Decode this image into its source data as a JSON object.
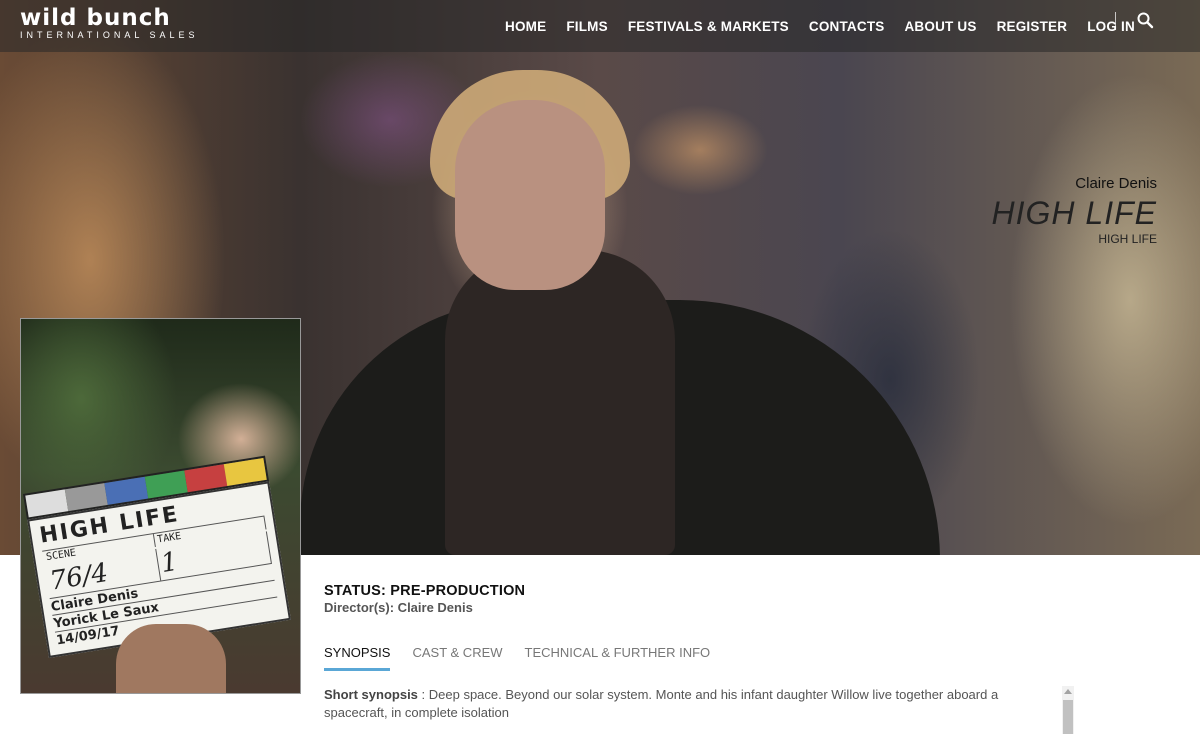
{
  "logo": {
    "main": "wild bunch",
    "sub": "INTERNATIONAL SALES"
  },
  "nav": {
    "items": [
      {
        "label": "HOME"
      },
      {
        "label": "FILMS"
      },
      {
        "label": "FESTIVALS & MARKETS"
      },
      {
        "label": "CONTACTS"
      },
      {
        "label": "ABOUT US"
      },
      {
        "label": "REGISTER"
      },
      {
        "label": "LOG IN"
      }
    ],
    "search_icon": "search-icon"
  },
  "hero": {
    "director": "Claire Denis",
    "title": "HIGH LIFE",
    "subtitle": "HIGH LIFE"
  },
  "poster": {
    "clapper_title": "HIGH LIFE",
    "scene_label": "SCENE",
    "take_label": "TAKE",
    "scene_value": "76/4",
    "take_value": "1",
    "director_line": "Claire Denis",
    "camera_line": "Yorick Le Saux",
    "date_line": "14/09/17",
    "stripe_colors": [
      "#dddddd",
      "#999999",
      "#4a6fb5",
      "#3f9f55",
      "#c64040",
      "#e8c640"
    ]
  },
  "info": {
    "status": "STATUS: PRE-PRODUCTION",
    "directors": "Director(s): Claire Denis"
  },
  "tabs": [
    {
      "label": "SYNOPSIS",
      "active": true
    },
    {
      "label": "CAST & CREW",
      "active": false
    },
    {
      "label": "TECHNICAL & FURTHER INFO",
      "active": false
    }
  ],
  "synopsis": {
    "label": "Short synopsis",
    "text": " : Deep space. Beyond our solar system. Monte and his infant daughter Willow live together aboard a spacecraft, in complete isolation"
  },
  "colors": {
    "tab_accent": "#5aa7d6",
    "nav_text": "#ffffff"
  }
}
